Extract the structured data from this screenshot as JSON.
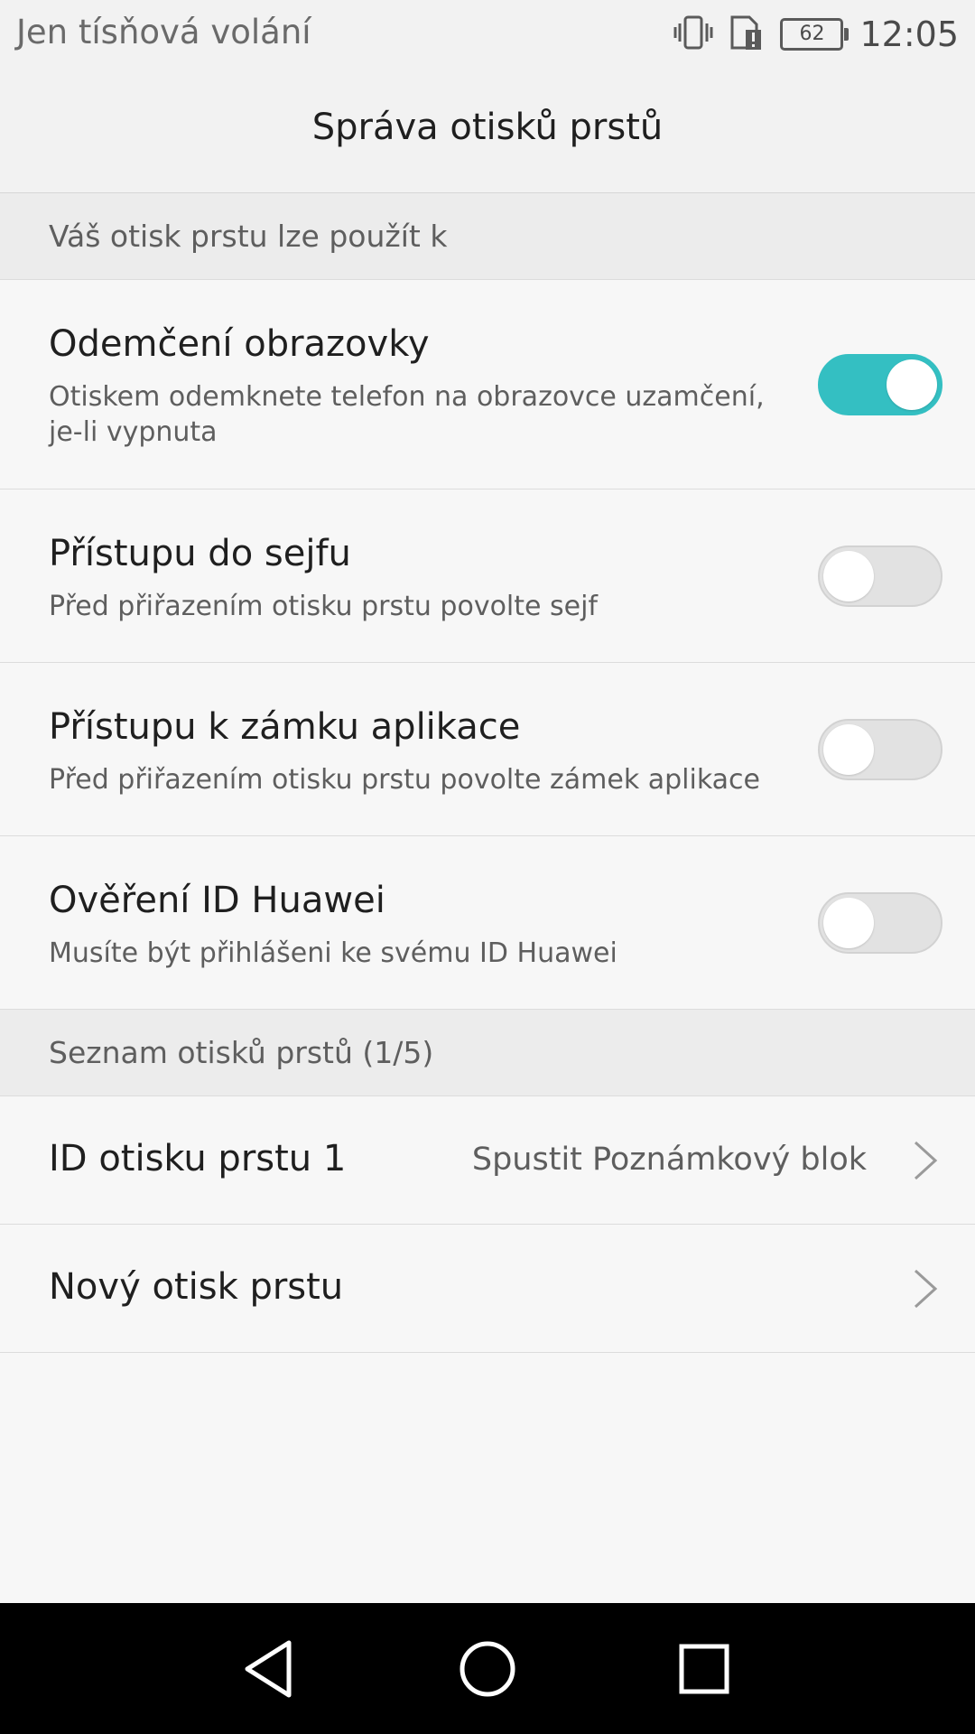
{
  "status_bar": {
    "carrier": "Jen tísňová volání",
    "battery": "62",
    "time": "12:05",
    "icons": [
      "vibrate-icon",
      "sim-alert-icon",
      "battery-icon"
    ]
  },
  "header": {
    "title": "Správa otisků prstů"
  },
  "section_usage": {
    "label": "Váš otisk prstu lze použít k"
  },
  "options": [
    {
      "title": "Odemčení obrazovky",
      "subtitle": "Otiskem odemknete telefon na obrazovce uzamčení, je-li vypnuta",
      "enabled": true
    },
    {
      "title": "Přístupu do sejfu",
      "subtitle": "Před přiřazením otisku prstu povolte sejf",
      "enabled": false
    },
    {
      "title": "Přístupu k zámku aplikace",
      "subtitle": "Před přiřazením otisku prstu povolte zámek aplikace",
      "enabled": false
    },
    {
      "title": "Ověření ID Huawei",
      "subtitle": "Musíte být přihlášeni ke svému ID Huawei",
      "enabled": false
    }
  ],
  "section_list": {
    "label": "Seznam otisků prstů (1/5)"
  },
  "fingerprints": [
    {
      "title": "ID otisku prstu 1",
      "value": "Spustit Poznámkový blok"
    },
    {
      "title": "Nový otisk prstu",
      "value": ""
    }
  ],
  "colors": {
    "accent": "#34bfc2",
    "background": "#f7f7f7",
    "section_background": "#ececec",
    "nav_bar": "#000000"
  },
  "nav_bar": {
    "buttons": [
      "back-icon",
      "home-icon",
      "recents-icon"
    ]
  }
}
